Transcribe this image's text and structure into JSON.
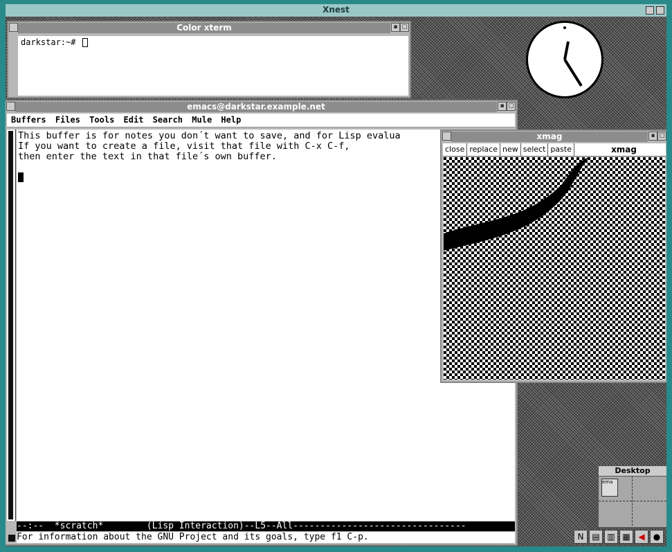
{
  "xnest": {
    "title": "Xnest"
  },
  "xterm": {
    "title": "Color xterm",
    "prompt": "darkstar:~#"
  },
  "emacs": {
    "title": "emacs@darkstar.example.net",
    "menu": [
      "Buffers",
      "Files",
      "Tools",
      "Edit",
      "Search",
      "Mule",
      "Help"
    ],
    "buffer_lines": [
      "This buffer is for notes you don´t want to save, and for Lisp evalua",
      "If you want to create a file, visit that file with C-x C-f,",
      "then enter the text in that file´s own buffer."
    ],
    "modeline": "--:--  *scratch*        (Lisp Interaction)--L5--All--------------------------------",
    "echo": "For information about the GNU Project and its goals, type f1 C-p."
  },
  "xmag": {
    "title": "xmag",
    "buttons": [
      "close",
      "replace",
      "new",
      "select",
      "paste"
    ],
    "label": "xmag"
  },
  "pager": {
    "title": "Desktop",
    "mini_label": "ema"
  }
}
